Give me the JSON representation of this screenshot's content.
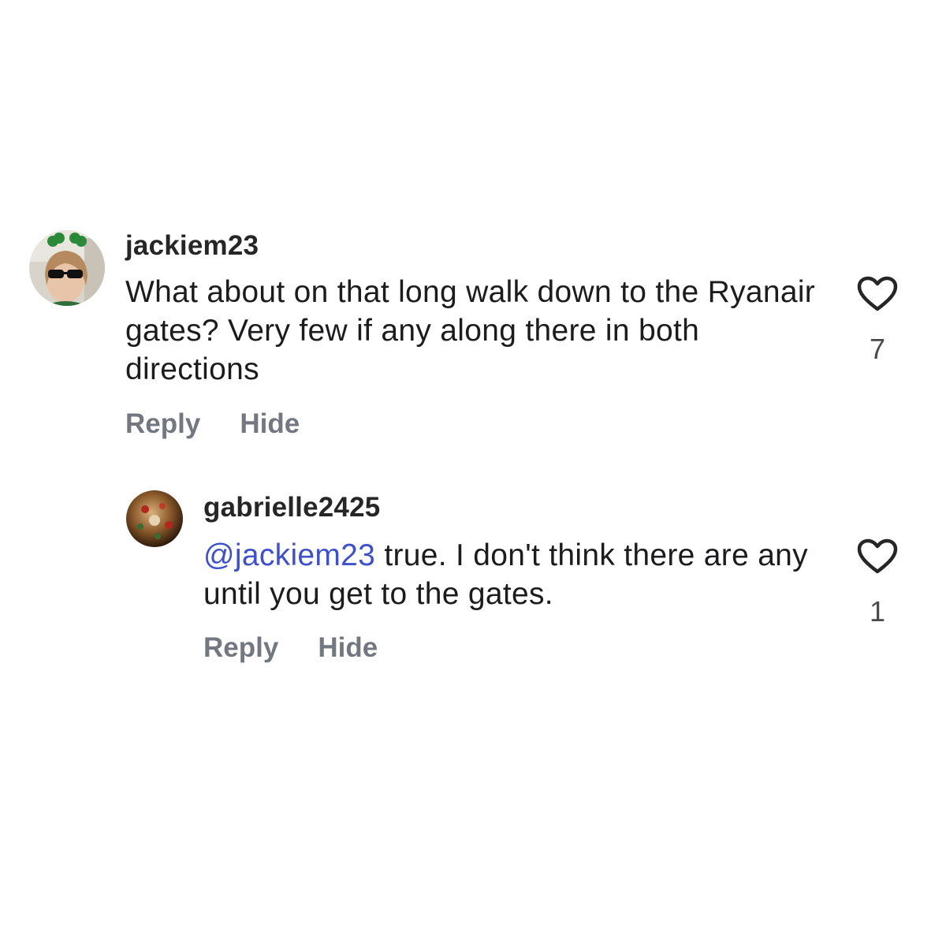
{
  "comments": [
    {
      "username": "jackiem23",
      "text": "What about on that long walk down to the Ryanair gates? Very few if any along there in both directions",
      "reply_label": "Reply",
      "hide_label": "Hide",
      "likes": "7",
      "avatar_icon": "avatar-photo-woman-sunglasses-shamrock"
    },
    {
      "username": "gabrielle2425",
      "mention": "@jackiem23",
      "text": "true. I don't think there are any until you get to the gates.",
      "reply_label": "Reply",
      "hide_label": "Hide",
      "likes": "1",
      "avatar_icon": "avatar-photo-ornament"
    }
  ],
  "colors": {
    "mention": "#3f51c8",
    "action_text": "#737880",
    "body_text": "#1c1c1e"
  }
}
